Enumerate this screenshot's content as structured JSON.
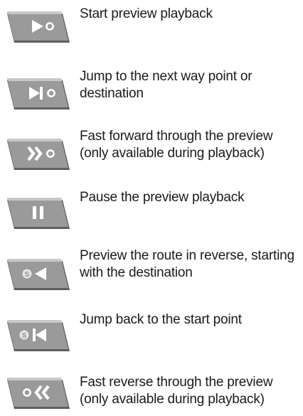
{
  "colors": {
    "button_face": "#8f8f8f",
    "button_bevel_light": "#d2d2d2",
    "button_bevel_dark": "#5f5f5f",
    "icon_white": "#ffffff",
    "icon_circle": "#ffffff"
  },
  "controls": [
    {
      "icon": "play-icon",
      "label": "Start preview playback"
    },
    {
      "icon": "next-waypoint-icon",
      "label": "Jump to the next way point or destination"
    },
    {
      "icon": "fast-forward-icon",
      "label": "Fast forward through the preview (only available during playback)"
    },
    {
      "icon": "pause-icon",
      "label": "Pause the preview playback"
    },
    {
      "icon": "reverse-play-icon",
      "label": "Preview the route in reverse, starting with the destination"
    },
    {
      "icon": "jump-to-start-icon",
      "label": "Jump back to the start point"
    },
    {
      "icon": "fast-reverse-icon",
      "label": "Fast reverse through the preview (only available during playback)"
    }
  ]
}
